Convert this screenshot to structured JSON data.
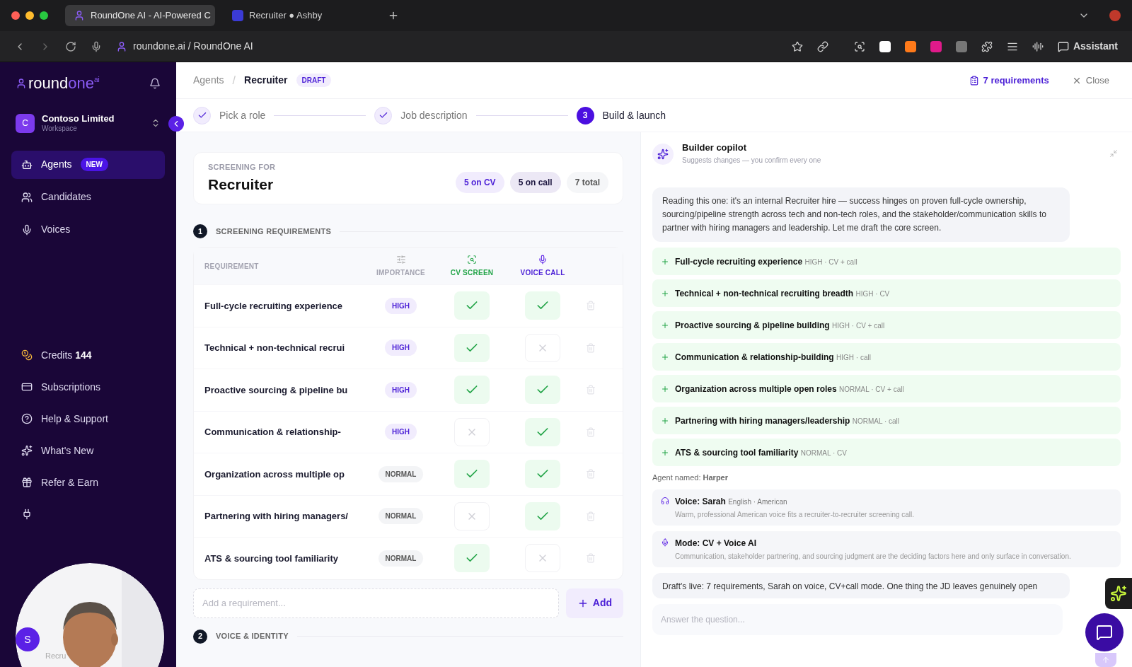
{
  "browser": {
    "tabs": [
      {
        "title": "RoundOne AI - AI-Powered C",
        "selected": true
      },
      {
        "title": "Recruiter ● Ashby",
        "selected": false
      }
    ],
    "address": "roundone.ai / RoundOne AI",
    "assistant": "Assistant"
  },
  "sidebar": {
    "logo": {
      "part_1": "round",
      "part_2": "one",
      "sup": "ai"
    },
    "workspace": {
      "initial": "C",
      "name": "Contoso Limited",
      "subtitle": "Workspace"
    },
    "nav": [
      {
        "kind": "agents",
        "label": "Agents",
        "badge": "NEW",
        "selected": true
      },
      {
        "kind": "candidates",
        "label": "Candidates",
        "selected": false
      },
      {
        "kind": "voices",
        "label": "Voices",
        "selected": false
      }
    ],
    "bottom": [
      {
        "kind": "credits",
        "label": "Credits",
        "value": "144"
      },
      {
        "kind": "subscriptions",
        "label": "Subscriptions"
      },
      {
        "kind": "help",
        "label": "Help & Support"
      },
      {
        "kind": "new",
        "label": "What's New"
      },
      {
        "kind": "refer",
        "label": "Refer & Earn"
      },
      {
        "kind": "plug"
      }
    ],
    "user": {
      "initial": "S",
      "label": "Recru"
    }
  },
  "header": {
    "breadcrumb": "Agents",
    "separator": "/",
    "title": "Recruiter",
    "badge": "DRAFT",
    "requirements": "7 requirements",
    "close": "Close"
  },
  "steps": [
    {
      "label": "Pick a role",
      "done": true
    },
    {
      "label": "Job description",
      "done": true
    },
    {
      "label": "Build & launch",
      "done": false,
      "number": "3"
    }
  ],
  "summary": {
    "label": "SCREENING FOR",
    "title": "Recruiter",
    "counts": [
      {
        "kind": "cv",
        "text": "5 on CV"
      },
      {
        "kind": "call",
        "text": "5 on call"
      },
      {
        "kind": "total",
        "text": "7 total"
      }
    ]
  },
  "section_1": {
    "number": "1",
    "title": "SCREENING REQUIREMENTS",
    "columns": [
      "REQUIREMENT",
      "IMPORTANCE",
      "CV SCREEN",
      "VOICE CALL"
    ],
    "rows": [
      {
        "name": "Full-cycle recruiting experience",
        "importance": "HIGH",
        "high": true,
        "cv": true,
        "call": true
      },
      {
        "name": "Technical + non-technical recrui",
        "importance": "HIGH",
        "high": true,
        "cv": true,
        "call": false
      },
      {
        "name": "Proactive sourcing & pipeline bu",
        "importance": "HIGH",
        "high": true,
        "cv": true,
        "call": true
      },
      {
        "name": "Communication & relationship-",
        "importance": "HIGH",
        "high": true,
        "cv": false,
        "call": true
      },
      {
        "name": "Organization across multiple op",
        "importance": "NORMAL",
        "high": false,
        "cv": true,
        "call": true
      },
      {
        "name": "Partnering with hiring managers/",
        "importance": "NORMAL",
        "high": false,
        "cv": false,
        "call": true
      },
      {
        "name": "ATS & sourcing tool familiarity",
        "importance": "NORMAL",
        "high": false,
        "cv": true,
        "call": false
      }
    ],
    "add_placeholder": "Add a requirement...",
    "add_button": "Add"
  },
  "section_2": {
    "number": "2",
    "title": "VOICE & IDENTITY"
  },
  "copilot": {
    "title": "Builder copilot",
    "subtitle": "Suggests changes — you confirm every one",
    "intro": "Reading this one: it's an internal Recruiter hire — success hinges on proven full-cycle ownership, sourcing/pipeline strength across tech and non-tech roles, and the stakeholder/communication skills to partner with hiring managers and leadership. Let me draft the core screen.",
    "suggestions": [
      {
        "name": "Full-cycle recruiting experience",
        "meta": "HIGH · CV + call"
      },
      {
        "name": "Technical + non-technical recruiting breadth",
        "meta": "HIGH · CV"
      },
      {
        "name": "Proactive sourcing & pipeline building",
        "meta": "HIGH · CV + call"
      },
      {
        "name": "Communication & relationship-building",
        "meta": "HIGH · call"
      },
      {
        "name": "Organization across multiple open roles",
        "meta": "NORMAL · CV + call"
      },
      {
        "name": "Partnering with hiring managers/leadership",
        "meta": "NORMAL · call"
      },
      {
        "name": "ATS & sourcing tool familiarity",
        "meta": "NORMAL · CV"
      }
    ],
    "agent_named": "Agent named: **Harper**",
    "cards": [
      {
        "kind": "voice",
        "title": "Voice: Sarah",
        "meta": "English · American",
        "body": "Warm, professional American voice fits a recruiter-to-recruiter screening call."
      },
      {
        "kind": "mode",
        "title": "Mode: CV + Voice AI",
        "body": "Communication, stakeholder partnering, and sourcing judgment are the deciding factors here and only surface in conversation."
      }
    ],
    "last_message": "Draft's live: 7 requirements, Sarah on voice, CV+call mode. One thing the JD leaves genuinely open",
    "input_placeholder": "Answer the question..."
  }
}
